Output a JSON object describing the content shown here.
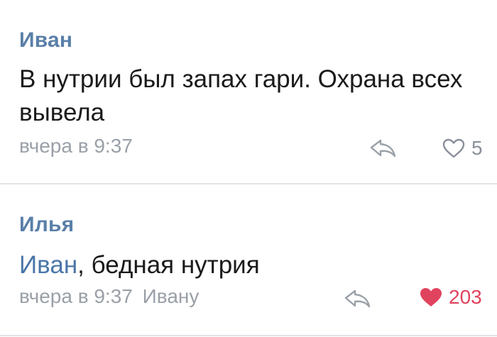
{
  "colors": {
    "author": "#5a7fa8",
    "mention": "#4a76a8",
    "meta": "#9aa0a8",
    "like_active": "#e0435d",
    "divider": "#e3e4e8"
  },
  "comments": [
    {
      "author": "Иван",
      "text": "В нутрии был запах гари. Охрана всех вывела",
      "time": "вчера в 9:37",
      "likes": "5",
      "liked": false,
      "icons": [
        "reply-arrow-icon",
        "heart-outline-icon"
      ]
    },
    {
      "author": "Илья",
      "mention": "Иван",
      "text": ", бедная нутрия",
      "time": "вчера в 9:37",
      "reply_to": "Ивану",
      "likes": "203",
      "liked": true,
      "icons": [
        "reply-arrow-icon",
        "heart-filled-icon"
      ]
    }
  ]
}
